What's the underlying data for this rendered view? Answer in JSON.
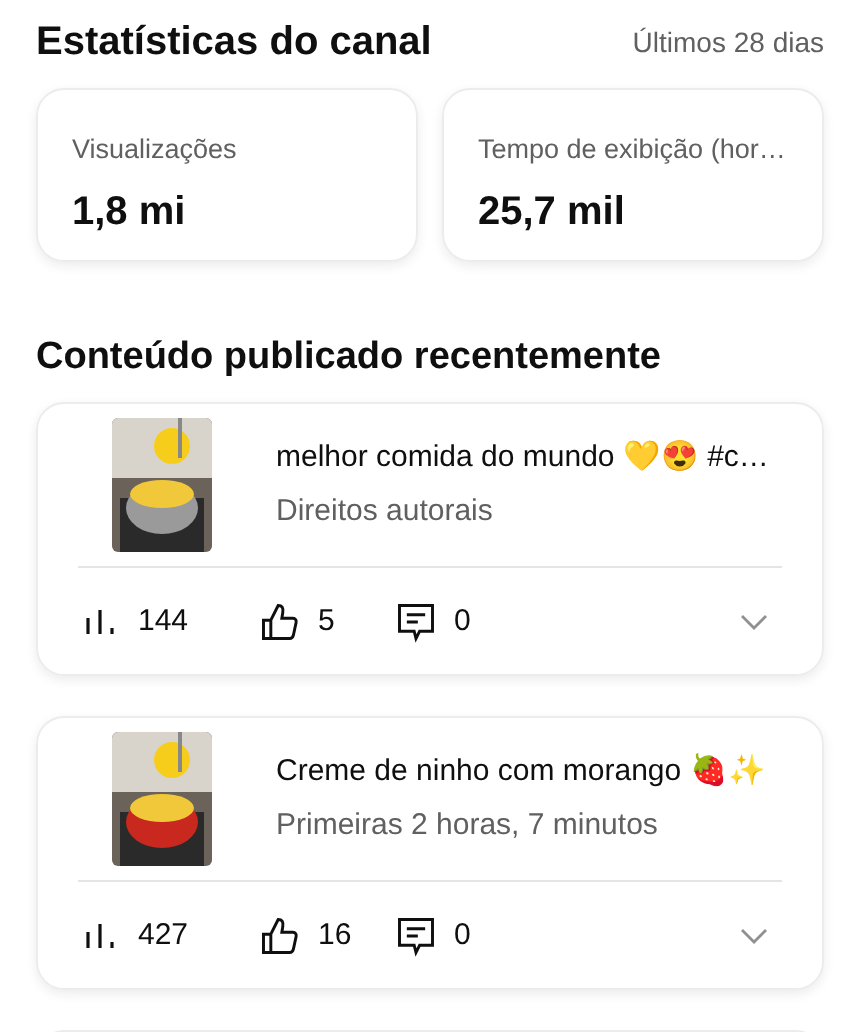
{
  "header": {
    "title": "Estatísticas do canal",
    "period": "Últimos 28 dias"
  },
  "stats": [
    {
      "label": "Visualizações",
      "value": "1,8 mi"
    },
    {
      "label": "Tempo de exibição (hor…",
      "value": "25,7 mil"
    }
  ],
  "section_title": "Conteúdo publicado recentemente",
  "videos": [
    {
      "title": "melhor comida do mundo 💛😍 #c…",
      "subtitle": "Direitos autorais",
      "views": "144",
      "likes": "5",
      "comments": "0"
    },
    {
      "title": "Creme de ninho com morango 🍓✨",
      "subtitle": "Primeiras 2 horas, 7 minutos",
      "views": "427",
      "likes": "16",
      "comments": "0"
    }
  ]
}
